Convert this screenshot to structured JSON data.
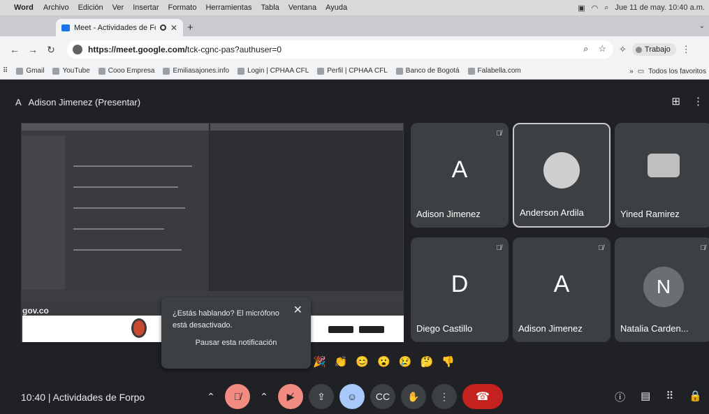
{
  "menubar": {
    "app": "Word",
    "items": [
      "Archivo",
      "Edición",
      "Ver",
      "Insertar",
      "Formato",
      "Herramientas",
      "Tabla",
      "Ventana",
      "Ayuda"
    ],
    "clock": "Jue 11 de may. 10:40 a.m."
  },
  "browser": {
    "tab_title": "Meet - Actividades de For",
    "new_tab": "+",
    "url_host": "https://meet.google.com/",
    "url_path": "tck-cgnc-pas?authuser=0",
    "profile_label": "Trabajo",
    "bookmarks": [
      "Gmail",
      "YouTube",
      "Cooo Empresa",
      "Emiliasajones.info",
      "Login | CPHAA CFL",
      "Perfil | CPHAA CFL",
      "Banco de Bogotá",
      "Falabella.com"
    ],
    "bookmarks_more": "»",
    "all_bookmarks": "Todos los favoritos"
  },
  "meet": {
    "presenter": "Adison Jimenez (Presentar)",
    "presenter_initial": "A",
    "shared": {
      "gov_label": "gov.co"
    },
    "participants": [
      {
        "name": "Adison Jimenez",
        "initial": "A",
        "muted": true
      },
      {
        "name": "Anderson Ardila",
        "initial": "",
        "muted": false,
        "active": true
      },
      {
        "name": "Yined Ramirez",
        "initial": "",
        "muted": false
      },
      {
        "name": "Diego Castillo",
        "initial": "D",
        "muted": true
      },
      {
        "name": "Adison Jimenez",
        "initial": "A",
        "muted": true
      },
      {
        "name": "Natalia Carden...",
        "initial": "N",
        "muted": true
      }
    ],
    "notice": {
      "message": "¿Estás hablando? El micrófono está desactivado.",
      "pause": "Pausar esta notificación"
    },
    "reactions": [
      "🎉",
      "👏",
      "😊",
      "😮",
      "😢",
      "🤔",
      "👎"
    ],
    "meeting_info": "10:40  |  Actividades de Forpo"
  }
}
